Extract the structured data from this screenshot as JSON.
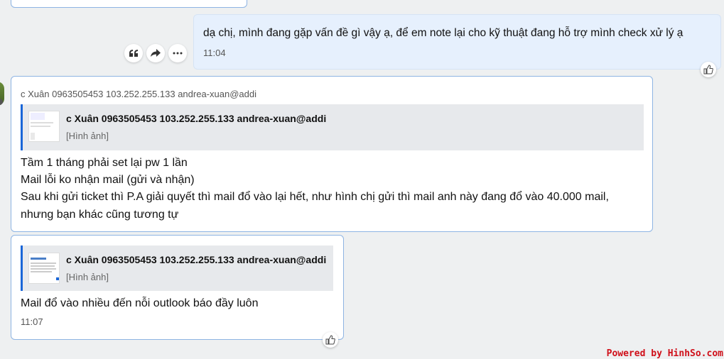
{
  "outgoing_message": {
    "text": "dạ chị, mình đang gặp vấn đề gì vậy ạ, để em note lại cho kỹ thuật đang hỗ trợ mình check xử lý ạ",
    "time": "11:04"
  },
  "message_actions": [
    {
      "name": "quote-button",
      "icon": "quote-icon"
    },
    {
      "name": "forward-button",
      "icon": "forward-icon"
    },
    {
      "name": "more-button",
      "icon": "more-icon"
    }
  ],
  "incoming_message_1": {
    "sender_line": "c Xuân 0963505453 103.252.255.133 andrea-xuan@addi",
    "quote": {
      "name": "c Xuân 0963505453 103.252.255.133 andrea-xuan@addi",
      "preview": "[Hình ảnh]"
    },
    "lines": [
      "Tầm 1 tháng phải set lại pw 1 lần",
      "Mail lỗi ko nhận mail (gửi và nhận)",
      "Sau khi gửi ticket thì P.A giải quyết thì mail đổ vào lại hết, như hình chị gửi thì mail anh này đang đổ vào 40.000 mail,",
      "nhưng bạn khác cũng tương tự"
    ]
  },
  "incoming_message_2": {
    "quote": {
      "name": "c Xuân 0963505453 103.252.255.133 andrea-xuan@addi",
      "preview": "[Hình ảnh]"
    },
    "text": "Mail đổ vào nhiều đến nỗi outlook báo đầy luôn",
    "time": "11:07"
  },
  "reaction_icon": "thumbs-up-icon",
  "watermark": "Powered by HinhSo.com",
  "colors": {
    "background": "#eef0f1",
    "incoming_border": "#8eb4e3",
    "outgoing_bubble": "#e6f0fd",
    "quote_accent": "#1a66d8",
    "watermark": "#d0101a"
  }
}
